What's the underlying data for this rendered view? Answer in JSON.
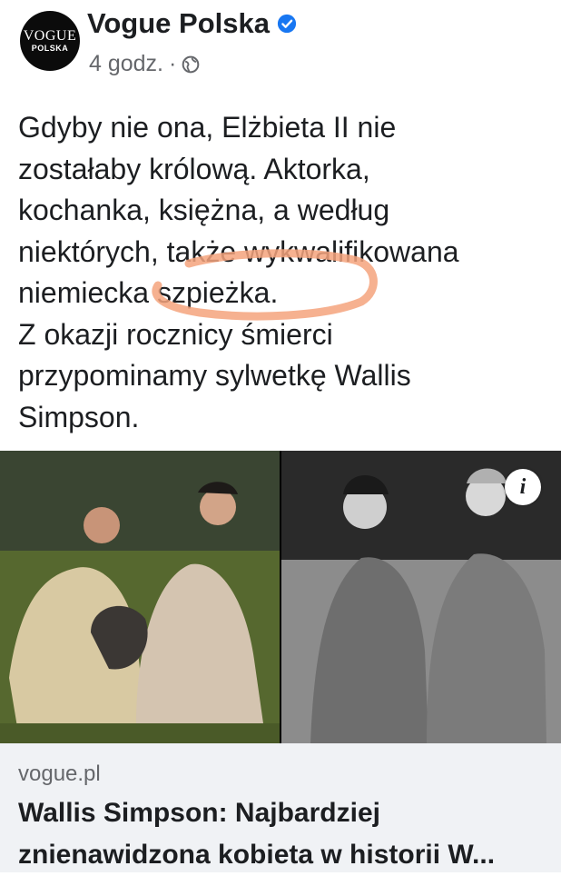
{
  "post": {
    "page_name": "Vogue Polska",
    "avatar_logo": "VOGUE",
    "avatar_sub": "POLSKA",
    "time": "4 godz.",
    "separator": "·",
    "icons": {
      "verified": "verified-badge-icon",
      "audience": "globe-icon",
      "info": "info-icon"
    },
    "text_lines": [
      "Gdyby nie ona, Elżbieta II nie",
      "zostałaby królową. Aktorka,",
      "kochanka, księżna, a według",
      "niektórych, także wykwalifikowana",
      "niemiecka szpieżka.",
      "Z okazji rocznicy śmierci",
      "przypominamy sylwetkę Wallis",
      "Simpson."
    ],
    "info_label": "i"
  },
  "link": {
    "domain": "vogue.pl",
    "title": "Wallis Simpson: Najbardziej znienawidzona kobieta w historii W..."
  },
  "colors": {
    "text": "#1c1e21",
    "secondary": "#65676b",
    "verified": "#1877f2",
    "highlight": "#f4a37c",
    "link_bg": "#f0f2f5"
  }
}
